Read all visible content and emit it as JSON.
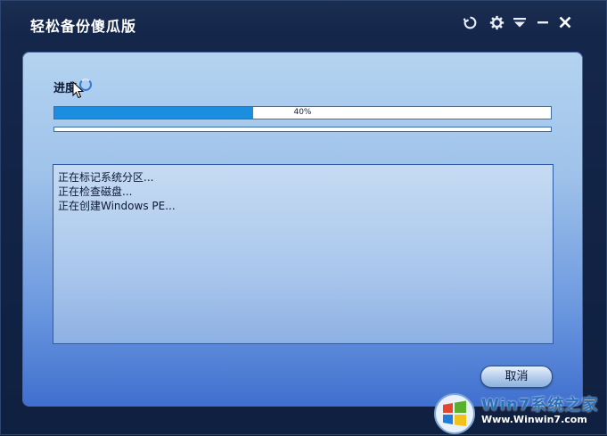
{
  "window": {
    "title": "轻松备份傻瓜版"
  },
  "titlebar_icons": [
    {
      "name": "refresh-icon"
    },
    {
      "name": "gear-icon"
    },
    {
      "name": "menu-dropdown-icon"
    },
    {
      "name": "minimize-icon"
    },
    {
      "name": "close-icon"
    }
  ],
  "progress": {
    "label": "进度",
    "percent_text": "40%",
    "value": 0.4,
    "fill_color": "#1c8ee0"
  },
  "log": {
    "lines": [
      "正在标记系统分区...",
      "正在检查磁盘...",
      "正在创建Windows PE..."
    ]
  },
  "buttons": {
    "cancel_label": "取消"
  },
  "watermark": {
    "logo_text": "Win7系统之家",
    "url": "Www.Winwin7.com"
  }
}
